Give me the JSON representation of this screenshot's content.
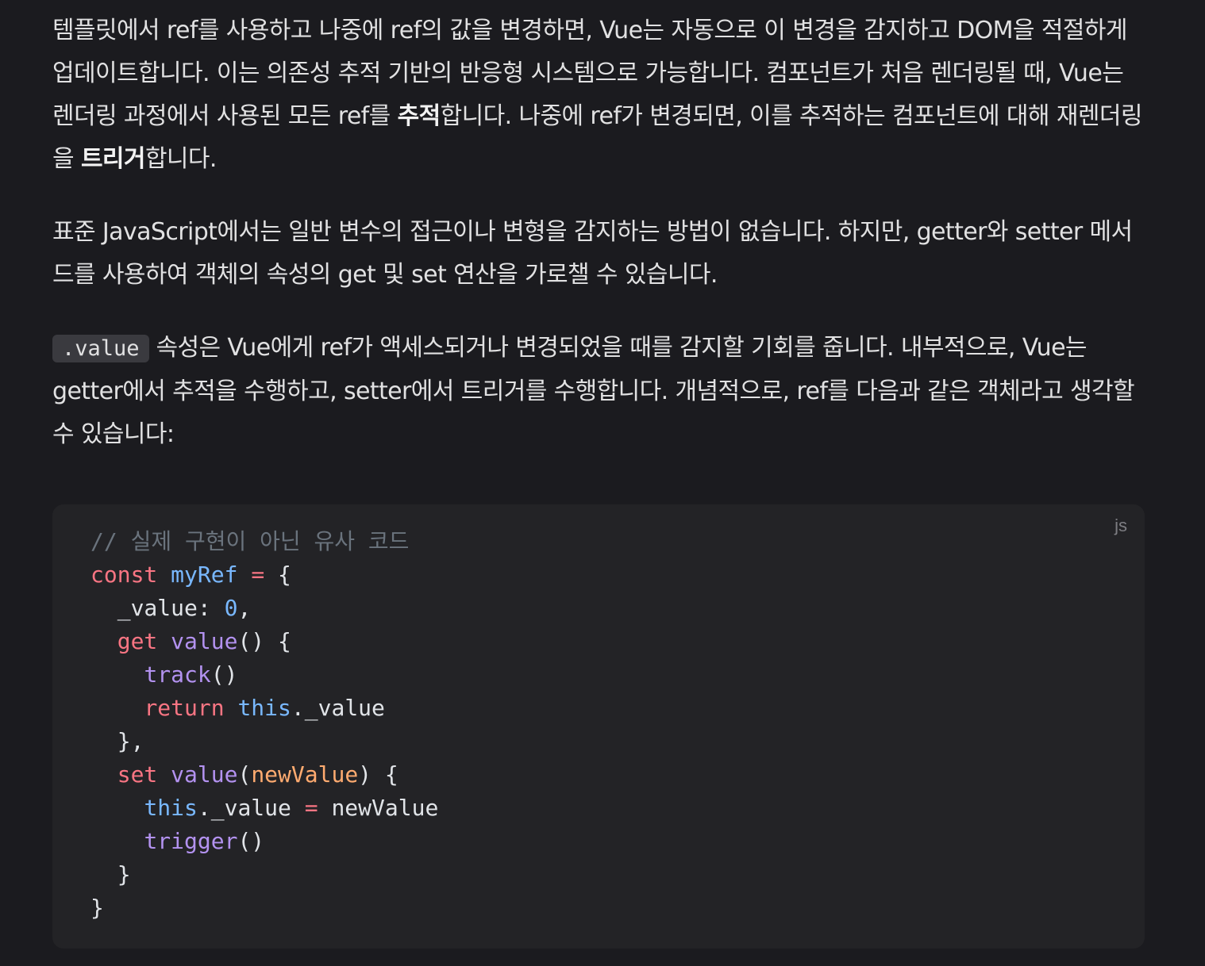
{
  "paragraphs": {
    "p1": {
      "t1": "템플릿에서 ref를 사용하고 나중에 ref의 값을 변경하면, Vue는 자동으로 이 변경을 감지하고 DOM을 적절하게 업데이트합니다. 이는 의존성 추적 기반의 반응형 시스템으로 가능합니다. 컴포넌트가 처음 렌더링될 때, Vue는 렌더링 과정에서 사용된 모든 ref를 ",
      "b1": "추적",
      "t2": "합니다. 나중에 ref가 변경되면, 이를 추적하는 컴포넌트에 대해 재렌더링을 ",
      "b2": "트리거",
      "t3": "합니다."
    },
    "p2": {
      "text": "표준 JavaScript에서는 일반 변수의 접근이나 변형을 감지하는 방법이 없습니다. 하지만, getter와 setter 메서드를 사용하여 객체의 속성의 get 및 set 연산을 가로챌 수 있습니다."
    },
    "p3": {
      "code": ".value",
      "text": " 속성은 Vue에게 ref가 액세스되거나 변경되었을 때를 감지할 기회를 줍니다. 내부적으로, Vue는 getter에서 추적을 수행하고, setter에서 트리거를 수행합니다. 개념적으로, ref를 다음과 같은 객체라고 생각할 수 있습니다:"
    }
  },
  "code_block": {
    "language": "js",
    "lines": [
      [
        {
          "t": "// 실제 구현이 아닌 유사 코드",
          "c": "comment"
        }
      ],
      [
        {
          "t": "const",
          "c": "keyword"
        },
        {
          "t": " ",
          "c": "plain"
        },
        {
          "t": "myRef",
          "c": "var"
        },
        {
          "t": " ",
          "c": "plain"
        },
        {
          "t": "=",
          "c": "keyword"
        },
        {
          "t": " {",
          "c": "plain"
        }
      ],
      [
        {
          "t": "  _value: ",
          "c": "plain"
        },
        {
          "t": "0",
          "c": "num"
        },
        {
          "t": ",",
          "c": "plain"
        }
      ],
      [
        {
          "t": "  ",
          "c": "plain"
        },
        {
          "t": "get",
          "c": "keyword"
        },
        {
          "t": " ",
          "c": "plain"
        },
        {
          "t": "value",
          "c": "fn"
        },
        {
          "t": "() {",
          "c": "plain"
        }
      ],
      [
        {
          "t": "    ",
          "c": "plain"
        },
        {
          "t": "track",
          "c": "fn"
        },
        {
          "t": "()",
          "c": "plain"
        }
      ],
      [
        {
          "t": "    ",
          "c": "plain"
        },
        {
          "t": "return",
          "c": "keyword"
        },
        {
          "t": " ",
          "c": "plain"
        },
        {
          "t": "this",
          "c": "var"
        },
        {
          "t": "._value",
          "c": "plain"
        }
      ],
      [
        {
          "t": "  },",
          "c": "plain"
        }
      ],
      [
        {
          "t": "  ",
          "c": "plain"
        },
        {
          "t": "set",
          "c": "keyword"
        },
        {
          "t": " ",
          "c": "plain"
        },
        {
          "t": "value",
          "c": "fn"
        },
        {
          "t": "(",
          "c": "plain"
        },
        {
          "t": "newValue",
          "c": "param"
        },
        {
          "t": ") {",
          "c": "plain"
        }
      ],
      [
        {
          "t": "    ",
          "c": "plain"
        },
        {
          "t": "this",
          "c": "var"
        },
        {
          "t": "._value ",
          "c": "plain"
        },
        {
          "t": "=",
          "c": "keyword"
        },
        {
          "t": " newValue",
          "c": "plain"
        }
      ],
      [
        {
          "t": "    ",
          "c": "plain"
        },
        {
          "t": "trigger",
          "c": "fn"
        },
        {
          "t": "()",
          "c": "plain"
        }
      ],
      [
        {
          "t": "  }",
          "c": "plain"
        }
      ],
      [
        {
          "t": "}",
          "c": "plain"
        }
      ]
    ]
  },
  "colors": {
    "background": "#1b1b1f",
    "code_background": "#232326",
    "comment": "#6a737d",
    "keyword": "#f97583",
    "variable": "#79b8ff",
    "function": "#b392f0",
    "parameter": "#ffab70"
  }
}
